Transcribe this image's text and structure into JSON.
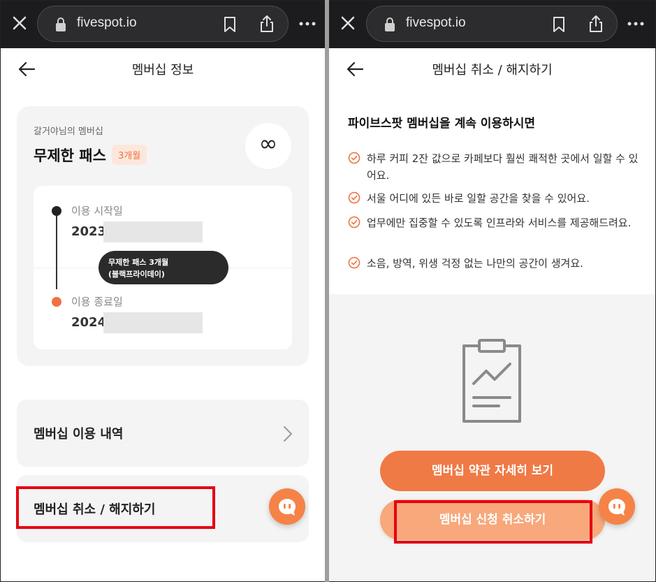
{
  "left": {
    "browser": {
      "url": "fivespot.io"
    },
    "header": {
      "title": "멤버십 정보"
    },
    "card": {
      "owner_label": "갈거야님의 멤버십",
      "pass_name": "무제한 패스",
      "duration_badge": "3개월",
      "infinity_symbol": "∞",
      "start_label": "이용 시작일",
      "start_value": "2023.",
      "end_label": "이용 종료일",
      "end_value": "2024.",
      "tooltip_line1": "무제한 패스 3개월",
      "tooltip_line2": "(블랙프라이데이)"
    },
    "menu": {
      "history_label": "멤버십 이용 내역",
      "cancel_label": "멤버십 취소 / 해지하기"
    }
  },
  "right": {
    "browser": {
      "url": "fivespot.io"
    },
    "header": {
      "title": "멤버십 취소 / 해지하기"
    },
    "heading": "파이브스팟 멤버십을 계속 이용하시면",
    "benefits": [
      "하루 커피 2잔 값으로 카페보다 훨씬 쾌적한 곳에서 일할 수 있어요.",
      "서울 어디에 있든 바로 일할 공간을 찾을 수 있어요.",
      "업무에만 집중할 수 있도록 인프라와 서비스를 제공해드려요.",
      "소음, 방역, 위생 걱정 없는 나만의 공간이 생겨요."
    ],
    "buttons": {
      "terms": "멤버십 약관 자세히 보기",
      "cancel": "멤버십 신청 취소하기"
    }
  },
  "colors": {
    "accent": "#f07a45",
    "accent_light": "#f8a87b",
    "highlight": "#e60012",
    "browser_bar": "#1c1c1e"
  },
  "icons": [
    "close-icon",
    "lock-icon",
    "bookmark-icon",
    "share-icon",
    "more-icon",
    "back-icon",
    "infinity-icon",
    "chevron-right-icon",
    "chat-icon",
    "check-icon",
    "clipboard-chart-icon"
  ]
}
